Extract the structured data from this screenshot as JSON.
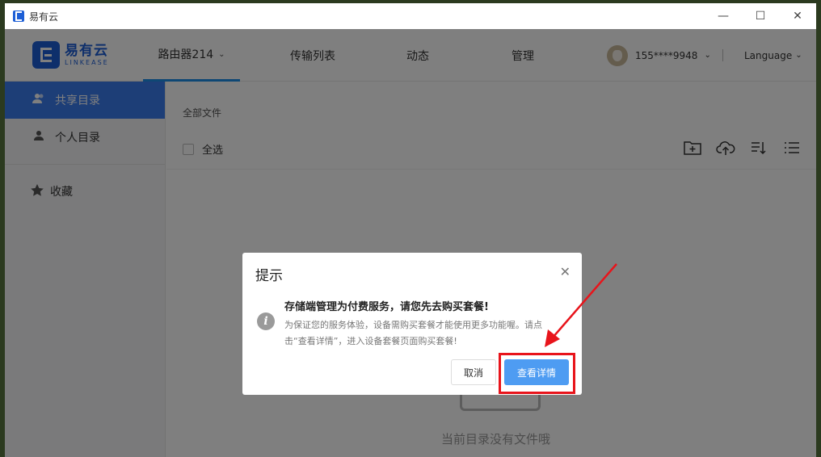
{
  "window": {
    "title": "易有云",
    "controls": {
      "minimize": "—",
      "maximize": "☐",
      "close": "✕"
    }
  },
  "logo": {
    "cn": "易有云",
    "en": "LINKEASE"
  },
  "nav": [
    {
      "label": "路由器214",
      "chevron": "⌄"
    },
    {
      "label": "传输列表"
    },
    {
      "label": "动态"
    },
    {
      "label": "管理"
    }
  ],
  "user": {
    "name": "155****9948",
    "chevron": "⌄"
  },
  "language": {
    "label": "Language",
    "chevron": "⌄"
  },
  "sidebar": {
    "items": [
      {
        "label": "共享目录",
        "icon": "users-icon"
      },
      {
        "label": "个人目录",
        "icon": "user-icon"
      },
      {
        "label": "收藏",
        "icon": "star-icon"
      }
    ]
  },
  "main": {
    "breadcrumb": "全部文件",
    "select_all": "全选",
    "empty_text": "当前目录没有文件哦"
  },
  "dialog": {
    "title": "提示",
    "close": "✕",
    "message": "存储端管理为付费服务，请您先去购买套餐!",
    "sub": "为保证您的服务体验，设备需购买套餐才能使用更多功能喔。请点击“查看详情”，进入设备套餐页面购买套餐!",
    "cancel_label": "取消",
    "detail_label": "查看详情"
  },
  "colors": {
    "accent": "#3b7cef",
    "brand": "#1d5fd6",
    "annotation": "#e8141b"
  }
}
